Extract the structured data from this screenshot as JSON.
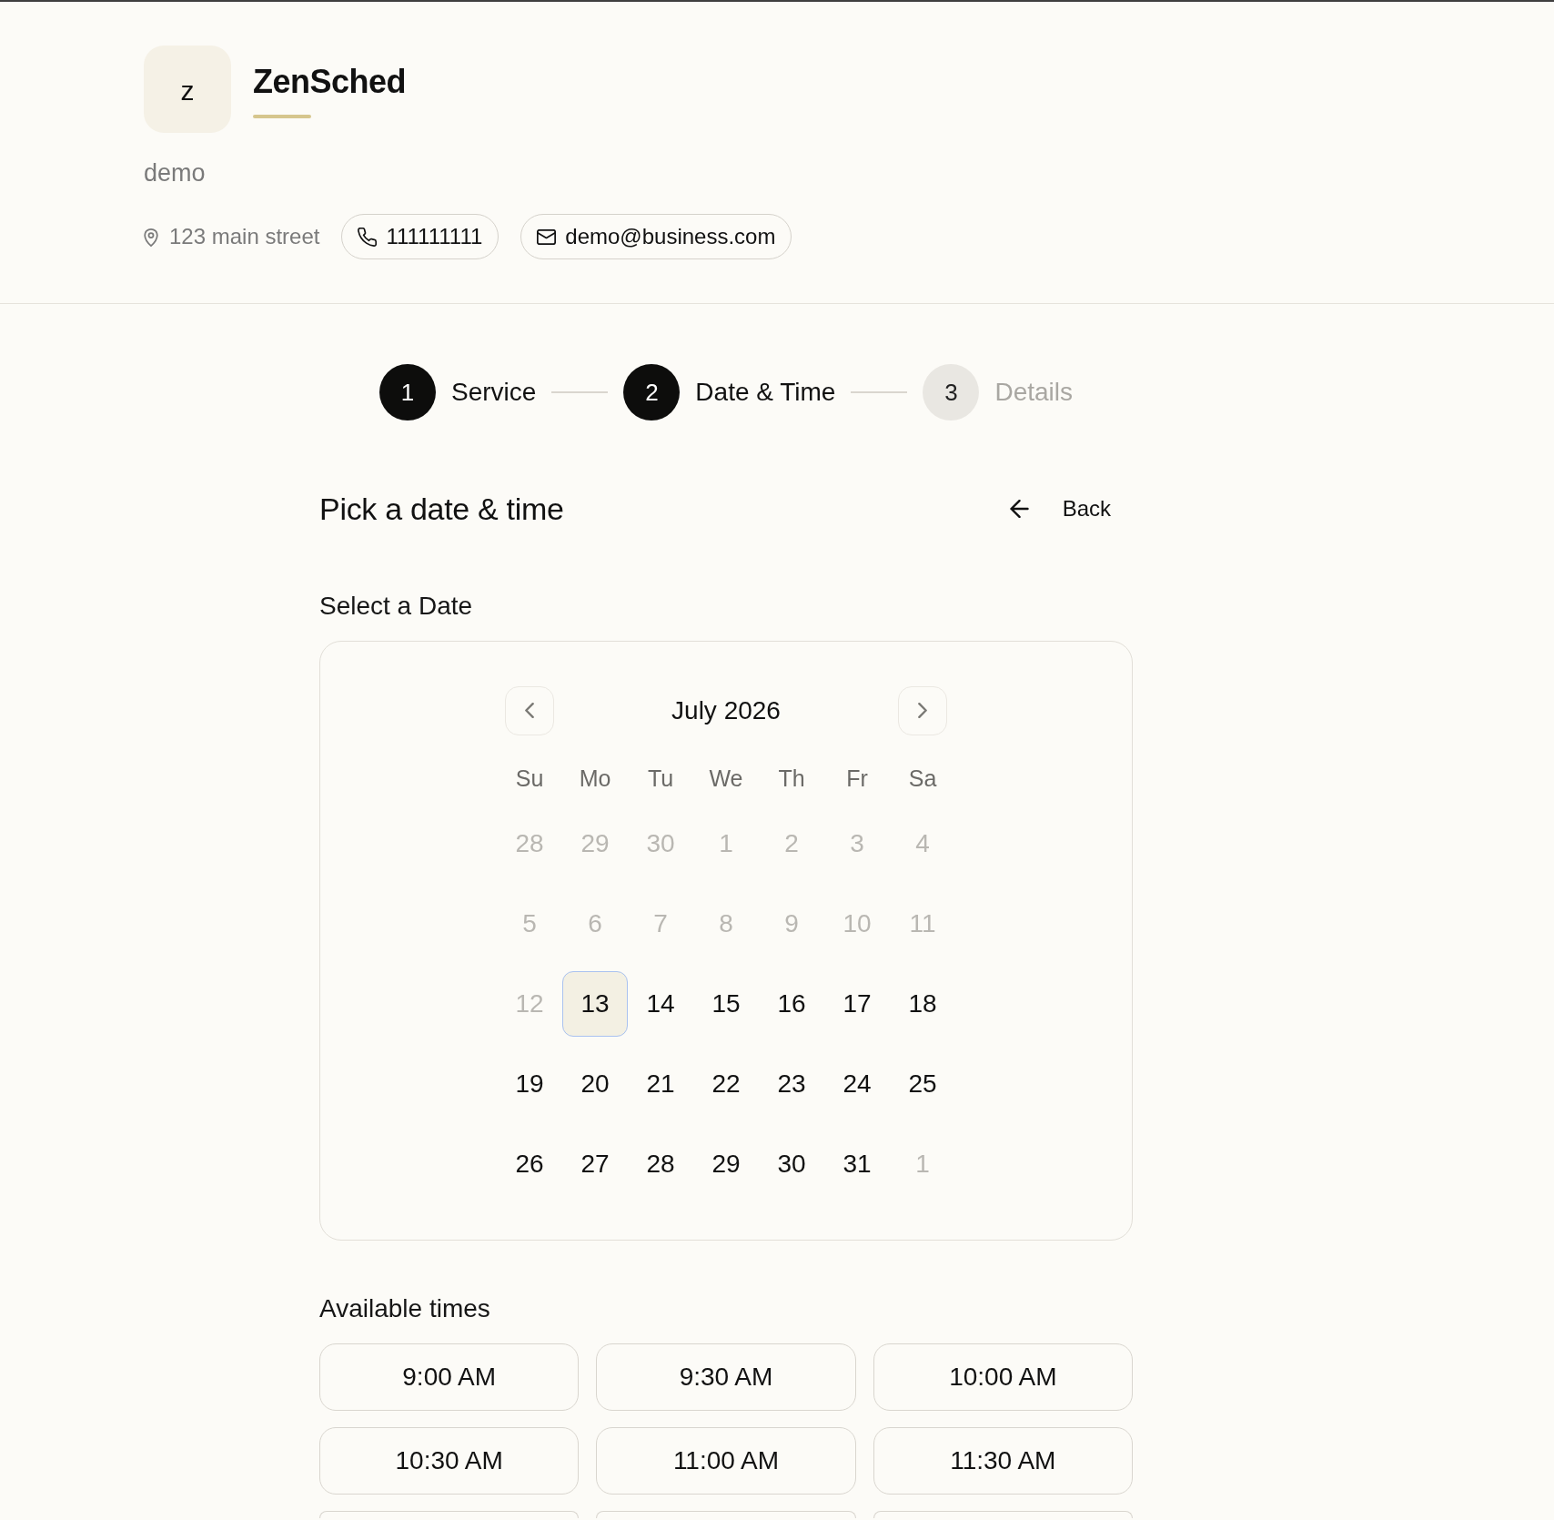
{
  "business": {
    "logo_letter": "z",
    "name": "ZenSched",
    "description": "demo",
    "address": "123 main street",
    "phone": "111111111",
    "email": "demo@business.com"
  },
  "steps": [
    {
      "number": "1",
      "label": "Service",
      "active": true
    },
    {
      "number": "2",
      "label": "Date & Time",
      "active": true
    },
    {
      "number": "3",
      "label": "Details",
      "active": false
    }
  ],
  "page": {
    "title": "Pick a date & time",
    "back": "Back"
  },
  "date_picker": {
    "label": "Select a Date",
    "month": "July 2026",
    "weekdays": [
      "Su",
      "Mo",
      "Tu",
      "We",
      "Th",
      "Fr",
      "Sa"
    ],
    "days": [
      {
        "label": "28",
        "disabled": true,
        "selected": false
      },
      {
        "label": "29",
        "disabled": true,
        "selected": false
      },
      {
        "label": "30",
        "disabled": true,
        "selected": false
      },
      {
        "label": "1",
        "disabled": true,
        "selected": false
      },
      {
        "label": "2",
        "disabled": true,
        "selected": false
      },
      {
        "label": "3",
        "disabled": true,
        "selected": false
      },
      {
        "label": "4",
        "disabled": true,
        "selected": false
      },
      {
        "label": "5",
        "disabled": true,
        "selected": false
      },
      {
        "label": "6",
        "disabled": true,
        "selected": false
      },
      {
        "label": "7",
        "disabled": true,
        "selected": false
      },
      {
        "label": "8",
        "disabled": true,
        "selected": false
      },
      {
        "label": "9",
        "disabled": true,
        "selected": false
      },
      {
        "label": "10",
        "disabled": true,
        "selected": false
      },
      {
        "label": "11",
        "disabled": true,
        "selected": false
      },
      {
        "label": "12",
        "disabled": true,
        "selected": false
      },
      {
        "label": "13",
        "disabled": false,
        "selected": true
      },
      {
        "label": "14",
        "disabled": false,
        "selected": false
      },
      {
        "label": "15",
        "disabled": false,
        "selected": false
      },
      {
        "label": "16",
        "disabled": false,
        "selected": false
      },
      {
        "label": "17",
        "disabled": false,
        "selected": false
      },
      {
        "label": "18",
        "disabled": false,
        "selected": false
      },
      {
        "label": "19",
        "disabled": false,
        "selected": false
      },
      {
        "label": "20",
        "disabled": false,
        "selected": false
      },
      {
        "label": "21",
        "disabled": false,
        "selected": false
      },
      {
        "label": "22",
        "disabled": false,
        "selected": false
      },
      {
        "label": "23",
        "disabled": false,
        "selected": false
      },
      {
        "label": "24",
        "disabled": false,
        "selected": false
      },
      {
        "label": "25",
        "disabled": false,
        "selected": false
      },
      {
        "label": "26",
        "disabled": false,
        "selected": false
      },
      {
        "label": "27",
        "disabled": false,
        "selected": false
      },
      {
        "label": "28",
        "disabled": false,
        "selected": false
      },
      {
        "label": "29",
        "disabled": false,
        "selected": false
      },
      {
        "label": "30",
        "disabled": false,
        "selected": false
      },
      {
        "label": "31",
        "disabled": false,
        "selected": false
      },
      {
        "label": "1",
        "disabled": true,
        "selected": false
      }
    ]
  },
  "times": {
    "label": "Available times",
    "slots": [
      {
        "kind": "slot",
        "label": "9:00 AM"
      },
      {
        "kind": "slot",
        "label": "9:30 AM"
      },
      {
        "kind": "slot",
        "label": "10:00 AM"
      },
      {
        "kind": "slot",
        "label": "10:30 AM"
      },
      {
        "kind": "slot",
        "label": "11:00 AM"
      },
      {
        "kind": "slot",
        "label": "11:30 AM"
      },
      {
        "kind": "cut-off"
      },
      {
        "kind": "cut-off"
      },
      {
        "kind": "cut-off"
      }
    ]
  }
}
